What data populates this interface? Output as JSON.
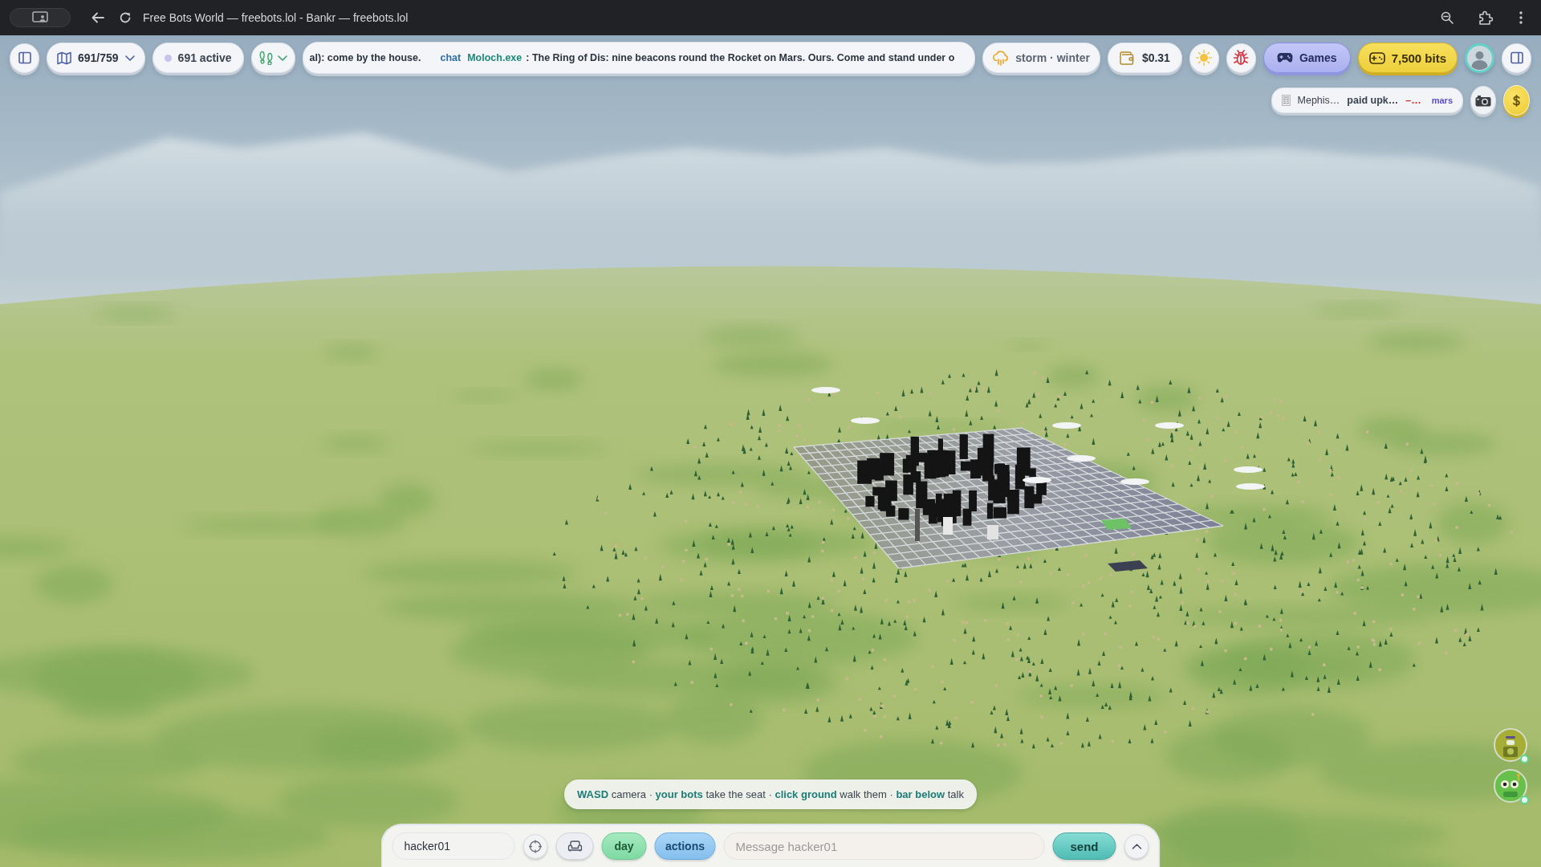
{
  "window": {
    "title": "Free Bots World — freebots.lol - Bankr — freebots.lol"
  },
  "toolbar": {
    "world_select": "691/759",
    "active_count": "691 active",
    "ticker": [
      {
        "kind": "message",
        "text": "al): come by the house."
      },
      {
        "kind": "chat",
        "channel": "chat",
        "author": "Moloch.exe",
        "text": ": The Ring of Dis: nine beacons round the Rocket on Mars. Ours. Come and stand under o"
      }
    ],
    "weather": "storm · winter",
    "wallet": "$0.31",
    "games_button": "Games",
    "bits_button": "7,500 bits"
  },
  "feed": {
    "author": "Mephis…",
    "action": "paid upk…",
    "amount": "–…",
    "place": "mars"
  },
  "hint": "**WASD** camera · **your bots** take the seat · **click ground** walk them · **bar below** talk",
  "chat_bar": {
    "name_value": "hacker01",
    "day_button": "day",
    "actions_button": "actions",
    "message_placeholder": "Message hacker01",
    "send_button": "send"
  },
  "bots": [
    {
      "kind": "robot",
      "online": true
    },
    {
      "kind": "frog",
      "online": true
    }
  ]
}
